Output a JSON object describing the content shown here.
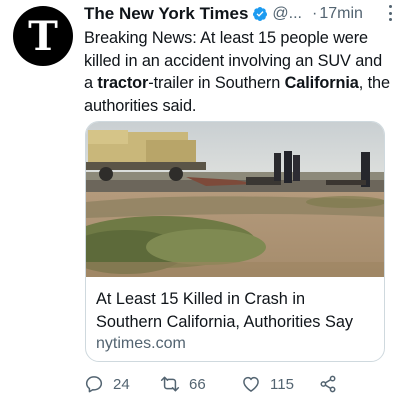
{
  "account": {
    "name": "The New York Times",
    "handle": "@...",
    "separator": "·",
    "time": "17min",
    "avatar_glyph": "T",
    "verified_color": "#1d9bf0"
  },
  "tweet": {
    "text_1": "Breaking News: At least 15 people were killed in an accident involving an SUV and a ",
    "text_bold_1": "tractor",
    "text_2": "-trailer in Southern ",
    "text_bold_2": "California",
    "text_3": ", the authorities said."
  },
  "card": {
    "title": "At Least 15 Killed in Crash in Southern California, Authorities Say",
    "domain": "nytimes.com"
  },
  "actions": {
    "replies": "24",
    "retweets": "66",
    "likes": "115"
  },
  "colors": {
    "text": "#0f1419",
    "secondary": "#536471",
    "border": "#cfd9de"
  }
}
